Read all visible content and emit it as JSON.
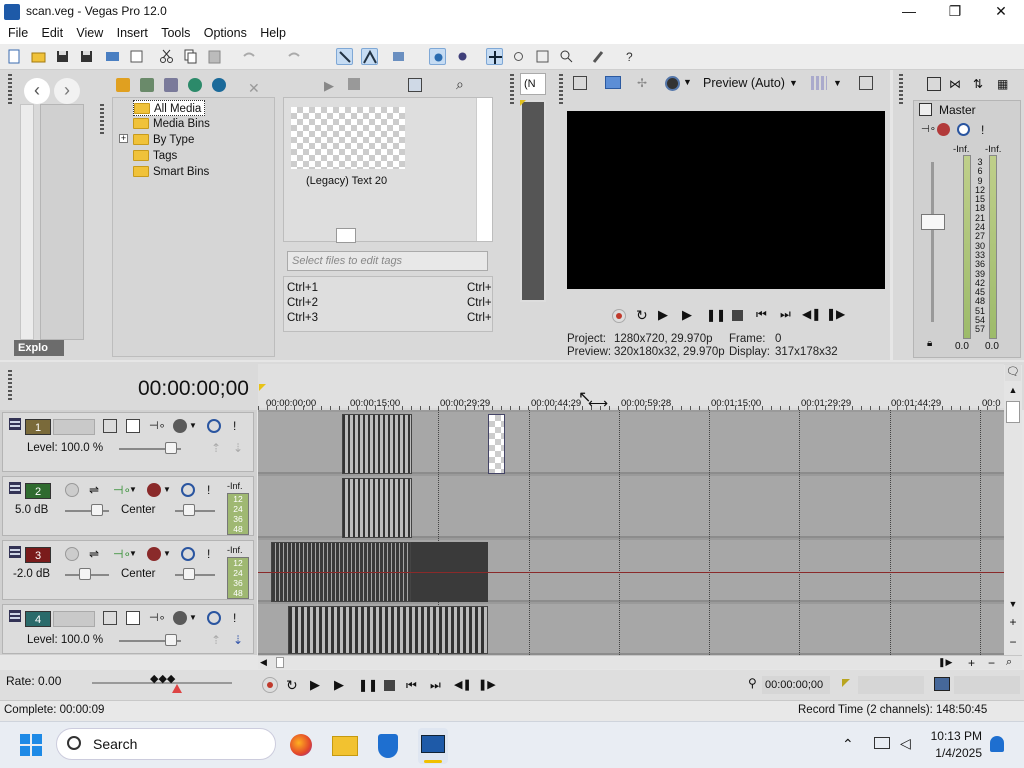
{
  "window": {
    "title": "scan.veg - Vegas Pro 12.0",
    "minimize": "—",
    "maximize": "❐",
    "close": "✕"
  },
  "menu": [
    "File",
    "Edit",
    "View",
    "Insert",
    "Tools",
    "Options",
    "Help"
  ],
  "explorer": {
    "tab_label": "Explo",
    "tree": [
      {
        "label": "All Media",
        "selected": true
      },
      {
        "label": "Media Bins"
      },
      {
        "label": "By Type",
        "expandable": true,
        "expander": "+"
      },
      {
        "label": "Tags"
      },
      {
        "label": "Smart Bins"
      }
    ],
    "media_item_label": "(Legacy) Text 20",
    "tags_placeholder": "Select files to edit tags",
    "shortcuts": [
      {
        "left": "Ctrl+1",
        "right": "Ctrl+"
      },
      {
        "left": "Ctrl+2",
        "right": "Ctrl+"
      },
      {
        "left": "Ctrl+3",
        "right": "Ctrl+"
      }
    ]
  },
  "trimmer_label": "(N",
  "preview": {
    "quality": "Preview (Auto)",
    "project_label": "Project:",
    "project_value": "1280x720, 29.970p",
    "preview_label": "Preview:",
    "preview_value": "320x180x32, 29.970p",
    "frame_label": "Frame:",
    "frame_value": "0",
    "display_label": "Display:",
    "display_value": "317x178x32"
  },
  "mixer": {
    "title": "Master",
    "left_peak": "-Inf.",
    "right_peak": "-Inf.",
    "scale": [
      "3",
      "6",
      "9",
      "12",
      "15",
      "18",
      "21",
      "24",
      "27",
      "30",
      "33",
      "36",
      "39",
      "42",
      "45",
      "48",
      "51",
      "54",
      "57"
    ],
    "left_value": "0.0",
    "right_value": "0.0"
  },
  "timeline": {
    "timecode": "00:00:00;00",
    "ruler": [
      "00:00:00;00",
      "00:00:15;00",
      "00:00:29;29",
      "00:00:44;29",
      "00:00:59;28",
      "00:01:15;00",
      "00:01:29;29",
      "00:01:44;29",
      "00:0"
    ],
    "tracks": [
      {
        "number": "1",
        "kind": "video",
        "level_text": "Level: 100.0 %"
      },
      {
        "number": "2",
        "kind": "audio",
        "volume": "5.0 dB",
        "pan": "Center",
        "meter_top": "-Inf.",
        "meter_scale": [
          "12",
          "24",
          "36",
          "48"
        ]
      },
      {
        "number": "3",
        "kind": "audio",
        "volume": "-2.0 dB",
        "pan": "Center",
        "meter_top": "-Inf.",
        "meter_scale": [
          "12",
          "24",
          "36",
          "48"
        ]
      },
      {
        "number": "4",
        "kind": "video",
        "level_text": "Level: 100.0 %"
      }
    ],
    "rate": "Rate: 0.00"
  },
  "transport": {
    "timecode": "00:00:00;00"
  },
  "status": {
    "left": "Complete: 00:00:09",
    "right": "Record Time (2 channels): 148:50:45"
  },
  "taskbar": {
    "search_label": "Search",
    "time": "10:13 PM",
    "date": "1/4/2025"
  },
  "colors": {
    "accent": "#1e5aa8",
    "track_red": "#7a1b1b",
    "track_green": "#2f6b2f",
    "clip_dark": "#3a3a3a"
  }
}
